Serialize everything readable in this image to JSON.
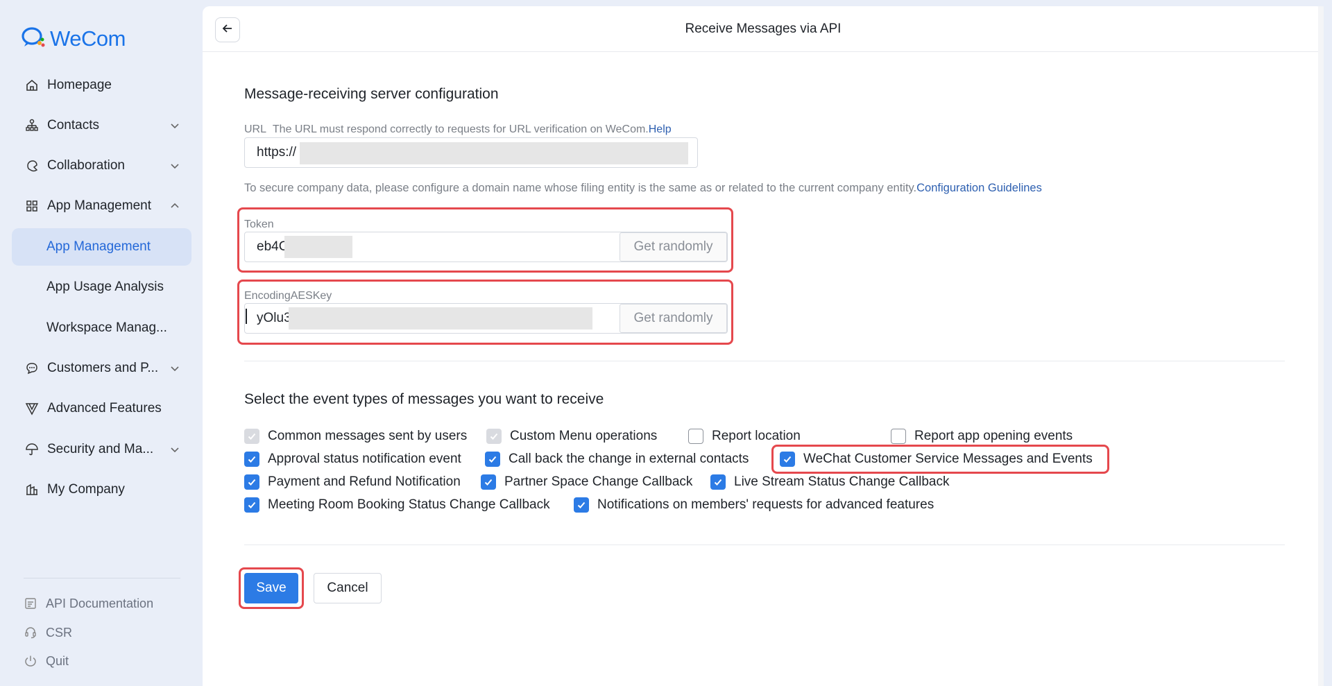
{
  "brand": {
    "name": "WeCom",
    "color": "#1a73e8",
    "logo_icon": "wecom-logo-icon"
  },
  "sidebar": {
    "items": [
      {
        "label": "Homepage",
        "icon": "home-icon"
      },
      {
        "label": "Contacts",
        "icon": "org-chart-icon"
      },
      {
        "label": "Collaboration",
        "icon": "collaboration-icon"
      },
      {
        "label": "App Management",
        "icon": "grid-icon"
      },
      {
        "label": "App Management",
        "active": true
      },
      {
        "label": "App Usage Analysis"
      },
      {
        "label": "Workspace Manag..."
      },
      {
        "label": "Customers and P...",
        "icon": "chat-bubble-icon"
      },
      {
        "label": "Advanced Features",
        "icon": "v-shape-icon"
      },
      {
        "label": "Security and Ma...",
        "icon": "umbrella-icon"
      },
      {
        "label": "My Company",
        "icon": "building-icon"
      }
    ],
    "footer": [
      {
        "label": "API Documentation",
        "icon": "document-icon"
      },
      {
        "label": "CSR",
        "icon": "headset-icon"
      },
      {
        "label": "Quit",
        "icon": "power-icon"
      }
    ]
  },
  "header": {
    "title": "Receive Messages via API",
    "back_icon": "arrow-left-icon"
  },
  "server_config": {
    "title": "Message-receiving server configuration",
    "url_label": "URL",
    "url_hint": "The URL must respond correctly to requests for URL verification on WeCom.",
    "url_help_link": "Help",
    "url_value": "https://",
    "domain_note": "To secure company data, please configure a domain name whose filing entity is the same as or related to the current company entity.",
    "domain_note_link": "Configuration Guidelines",
    "token_label": "Token",
    "token_value": "eb4C",
    "aes_label": "EncodingAESKey",
    "aes_value": "yOlu3",
    "get_randomly": "Get randomly"
  },
  "events": {
    "title": "Select the event types of messages you want to receive",
    "options": [
      {
        "label": "Common messages sent by users",
        "state": "checked-disabled"
      },
      {
        "label": "Custom Menu operations",
        "state": "checked-disabled"
      },
      {
        "label": "Report location",
        "state": "unchecked"
      },
      {
        "label": "Report app opening events",
        "state": "unchecked"
      },
      {
        "label": "Approval status notification event",
        "state": "checked"
      },
      {
        "label": "Call back the change in external contacts",
        "state": "checked"
      },
      {
        "label": "WeChat Customer Service Messages and Events",
        "state": "checked"
      },
      {
        "label": "Payment and Refund Notification",
        "state": "checked"
      },
      {
        "label": "Partner Space Change Callback",
        "state": "checked"
      },
      {
        "label": "Live Stream Status Change Callback",
        "state": "checked"
      },
      {
        "label": "Meeting Room Booking Status Change Callback",
        "state": "checked"
      },
      {
        "label": "Notifications on members' requests for advanced features",
        "state": "checked"
      }
    ]
  },
  "actions": {
    "save": "Save",
    "cancel": "Cancel"
  },
  "colors": {
    "accent": "#2c7be5",
    "highlight": "#e5484d",
    "link": "#2d5fb0"
  }
}
